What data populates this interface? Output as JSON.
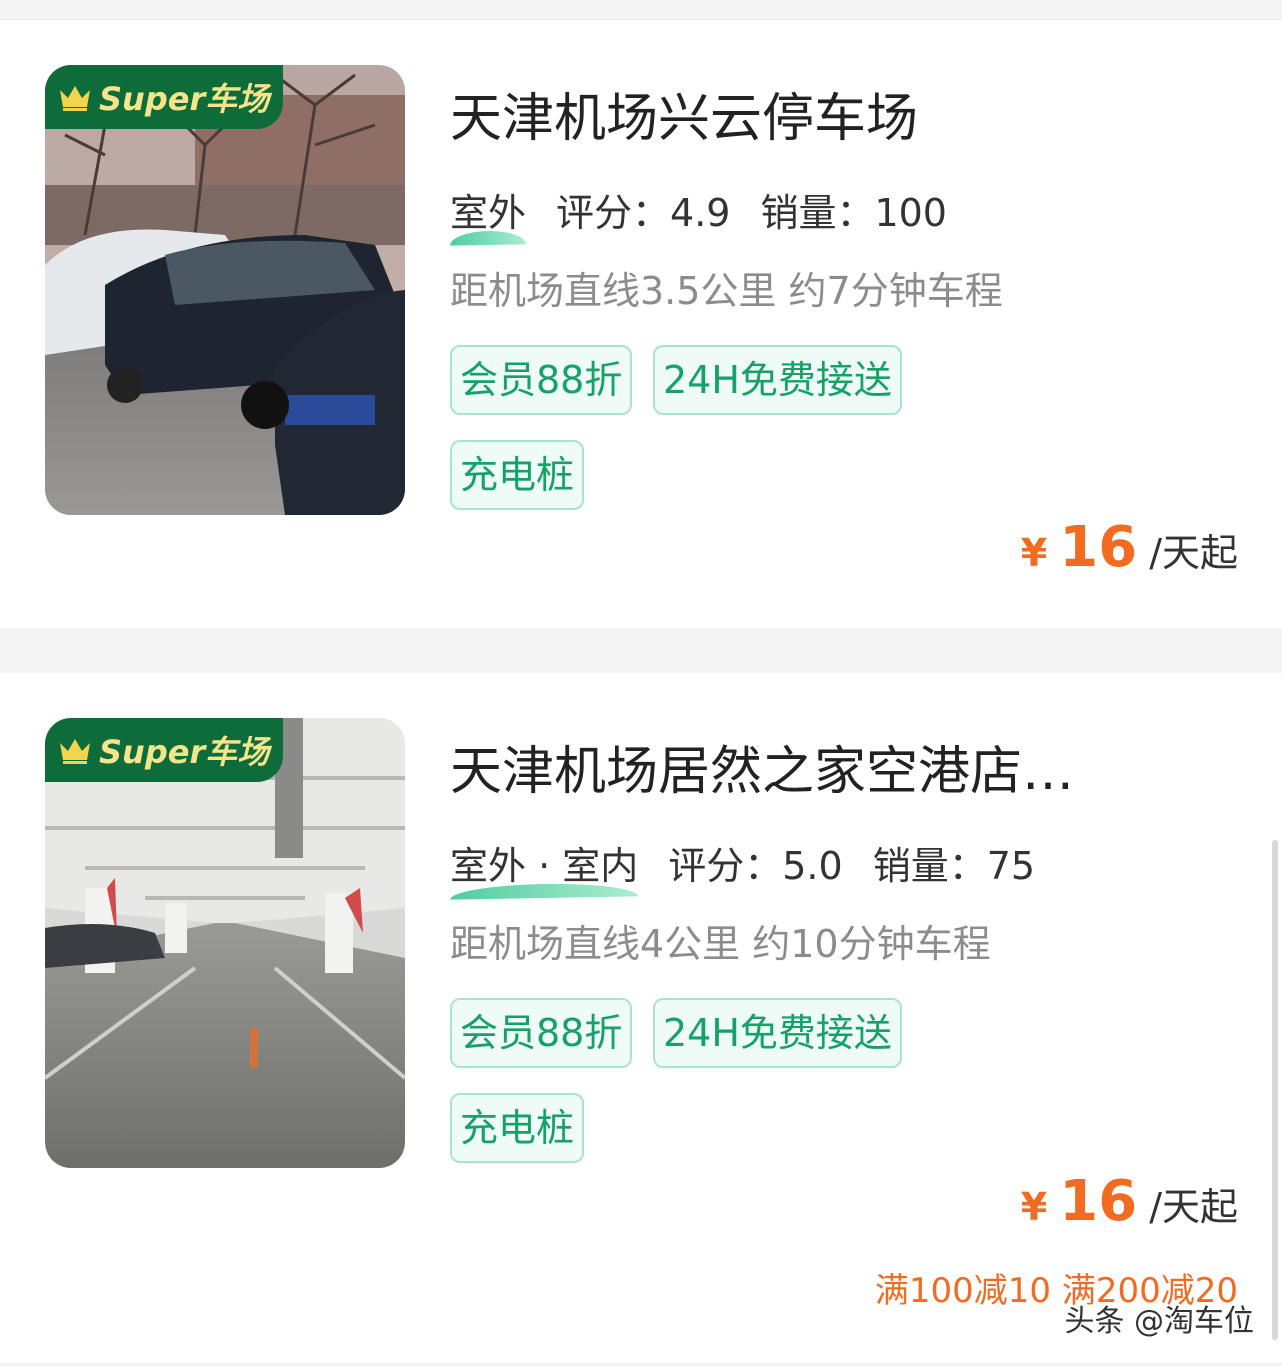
{
  "badge_text": "Super车场",
  "listings": [
    {
      "title": "天津机场兴云停车场",
      "type_tag": "室外",
      "rating_label": "评分：4.9",
      "sales_label": "销量：100",
      "distance": "距机场直线3.5公里 约7分钟车程",
      "tags": [
        "会员88折",
        "24H免费接送",
        "充电桩"
      ],
      "price_currency": "¥",
      "price_value": "16",
      "price_unit": "/天起",
      "image_scene": "outdoor-parking-lot"
    },
    {
      "title": "天津机场居然之家空港店…",
      "type_tag": "室外 · 室内",
      "rating_label": "评分：5.0",
      "sales_label": "销量：75",
      "distance": "距机场直线4公里 约10分钟车程",
      "tags": [
        "会员88折",
        "24H免费接送",
        "充电桩"
      ],
      "price_currency": "¥",
      "price_value": "16",
      "price_unit": "/天起",
      "promo": "满100减10 满200减20",
      "image_scene": "indoor-parking-garage"
    }
  ],
  "watermark": "头条 @淘车位",
  "colors": {
    "accent_green": "#16a06a",
    "badge_green": "#0e6b3a",
    "badge_text": "#f4e48a",
    "price_orange": "#f26b21"
  }
}
